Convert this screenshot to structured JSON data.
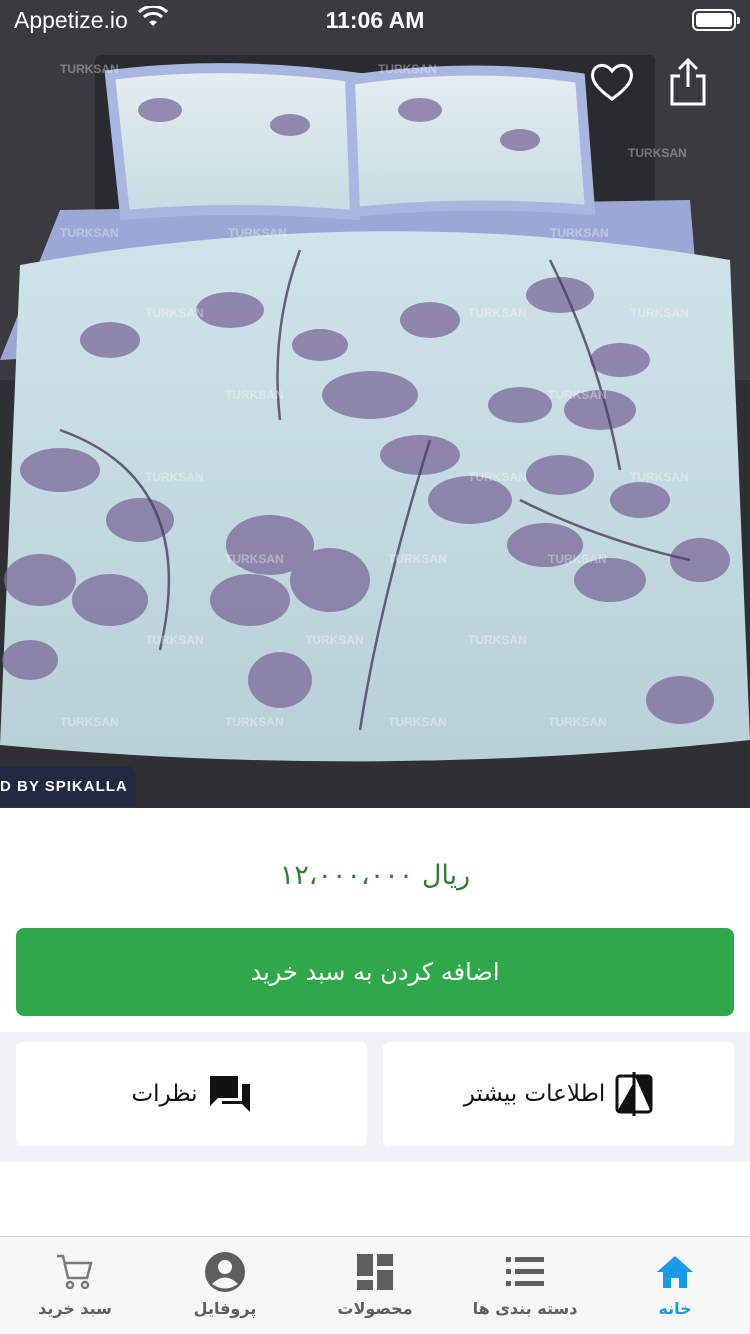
{
  "status_bar": {
    "carrier": "Appetize.io",
    "time": "11:06 AM"
  },
  "hero": {
    "watermark_text": "TURKSAN",
    "badge_text": "D BY SPIKALLA",
    "actions": [
      {
        "name": "favorite",
        "icon": "heart-icon"
      },
      {
        "name": "share",
        "icon": "share-icon"
      }
    ]
  },
  "product": {
    "price": "۱۲،۰۰۰،۰۰۰ ریال",
    "add_to_cart_label": "اضافه کردن به سبد خرید"
  },
  "cards": {
    "comments_label": "نظرات",
    "more_info_label": "اطلاعات بیشتر"
  },
  "tabbar": {
    "active_color": "#1a9ae6",
    "items": [
      {
        "label": "سبد خرید",
        "icon": "cart-icon"
      },
      {
        "label": "پروفایل",
        "icon": "profile-icon"
      },
      {
        "label": "محصولات",
        "icon": "products-grid-icon"
      },
      {
        "label": "دسته بندی ها",
        "icon": "categories-list-icon"
      },
      {
        "label": "خانه",
        "icon": "home-icon",
        "active": true
      }
    ]
  },
  "colors": {
    "price_green": "#2e7d32",
    "button_green": "#2ea84a",
    "tab_active": "#1a9ae6"
  }
}
